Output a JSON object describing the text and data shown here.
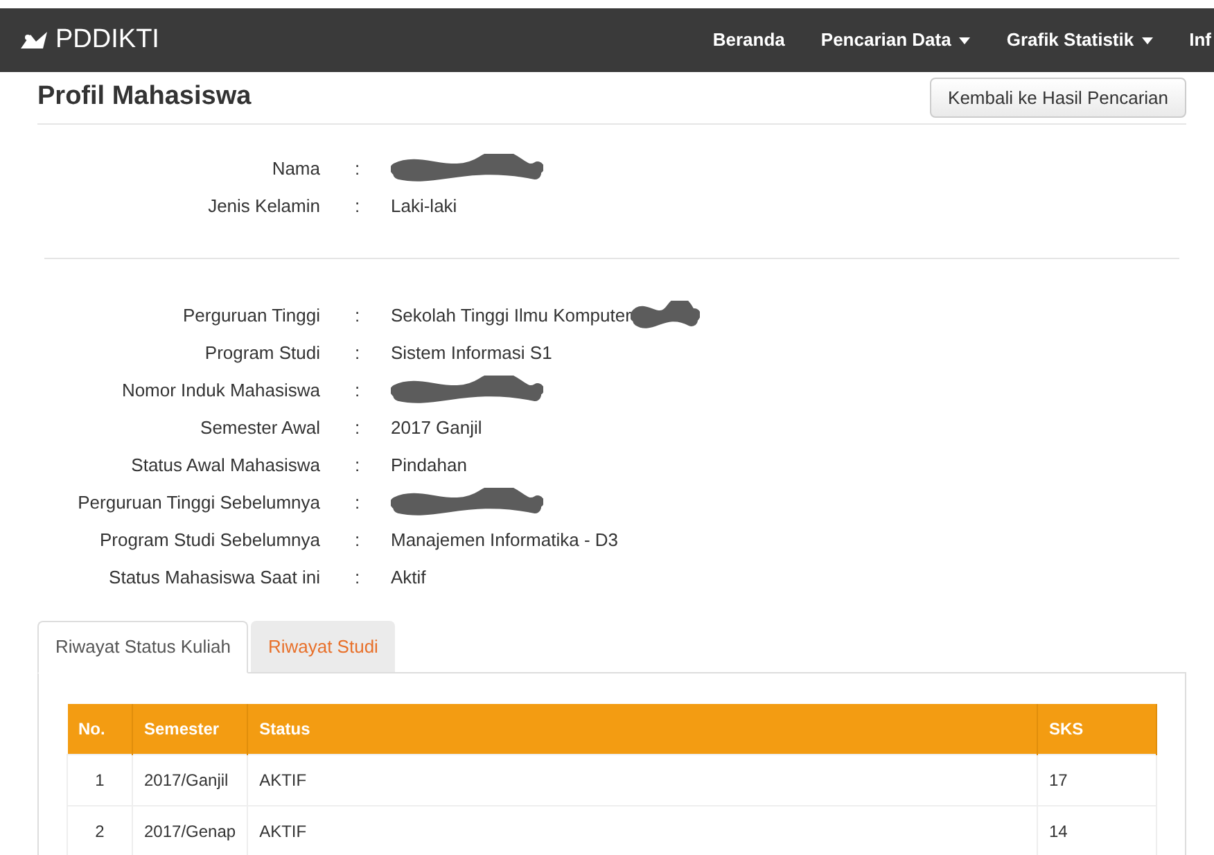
{
  "navbar": {
    "brand": "PDDIKTI",
    "items": [
      {
        "label": "Beranda",
        "dropdown": false
      },
      {
        "label": "Pencarian Data",
        "dropdown": true
      },
      {
        "label": "Grafik Statistik",
        "dropdown": true
      },
      {
        "label": "Inf",
        "dropdown": false
      }
    ]
  },
  "page": {
    "title": "Profil Mahasiswa",
    "back_button": "Kembali ke Hasil Pencarian"
  },
  "identity": [
    {
      "label": "Nama",
      "separator": ":",
      "redacted": true
    },
    {
      "label": "Jenis Kelamin",
      "separator": ":",
      "value": "Laki-laki",
      "redacted": false
    }
  ],
  "academic": [
    {
      "label": "Perguruan Tinggi",
      "separator": ":",
      "value": "Sekolah Tinggi Ilmu Komputer",
      "redacted": true
    },
    {
      "label": "Program Studi",
      "separator": ":",
      "value": "Sistem Informasi S1",
      "redacted": false
    },
    {
      "label": "Nomor Induk Mahasiswa",
      "separator": ":",
      "redacted": true
    },
    {
      "label": "Semester Awal",
      "separator": ":",
      "value": "2017 Ganjil",
      "redacted": false
    },
    {
      "label": "Status Awal Mahasiswa",
      "separator": ":",
      "value": "Pindahan",
      "redacted": false
    },
    {
      "label": "Perguruan Tinggi Sebelumnya",
      "separator": ":",
      "redacted": true
    },
    {
      "label": "Program Studi Sebelumnya",
      "separator": ":",
      "value": "Manajemen Informatika - D3",
      "redacted": false
    },
    {
      "label": "Status Mahasiswa Saat ini",
      "separator": ":",
      "value": "Aktif",
      "redacted": false
    }
  ],
  "tabs": [
    {
      "label": "Riwayat Status Kuliah",
      "selected": true
    },
    {
      "label": "Riwayat Studi",
      "selected": false
    }
  ],
  "table": {
    "columns": [
      "No.",
      "Semester",
      "Status",
      "SKS"
    ],
    "rows": [
      [
        "1",
        "2017/Ganjil",
        "AKTIF",
        "17"
      ],
      [
        "2",
        "2017/Genap",
        "AKTIF",
        "14"
      ]
    ]
  }
}
